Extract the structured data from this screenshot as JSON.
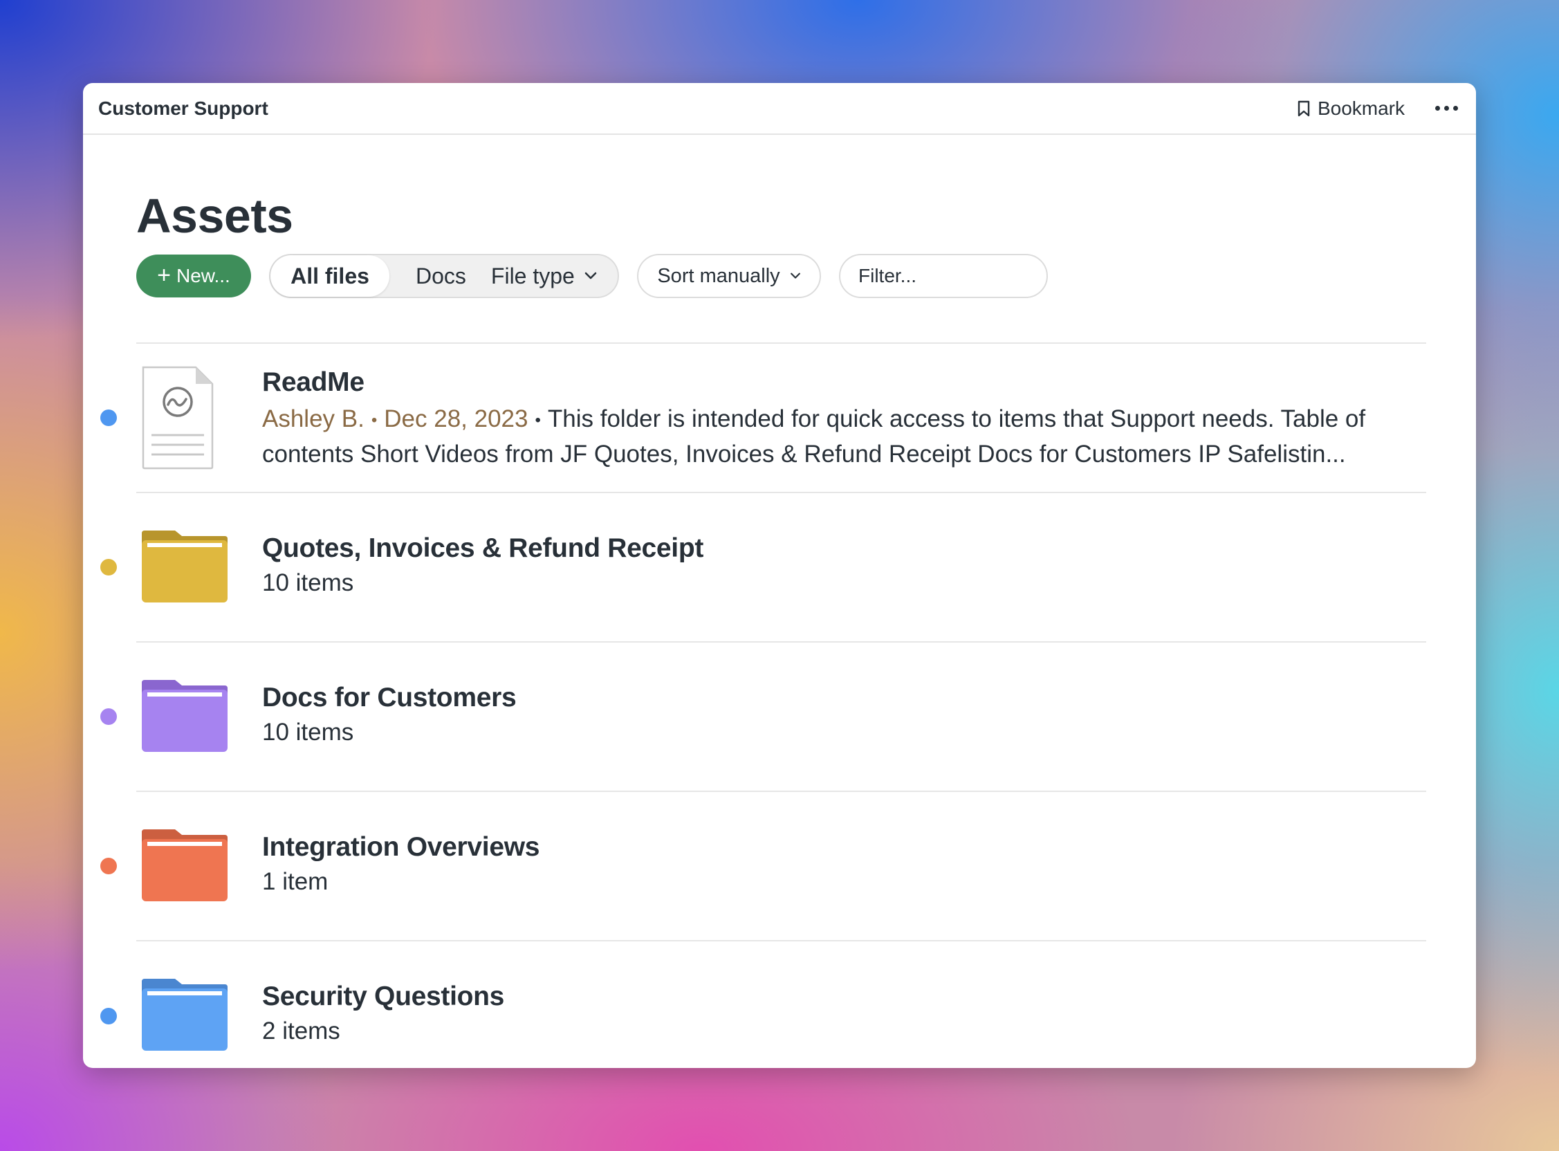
{
  "window": {
    "title": "Customer Support",
    "bookmark_label": "Bookmark"
  },
  "page": {
    "heading": "Assets"
  },
  "toolbar": {
    "new_label": "New...",
    "segments": [
      "All files",
      "Docs",
      "File type"
    ],
    "active_segment": "All files",
    "sort_label": "Sort manually",
    "filter_placeholder": "Filter..."
  },
  "items": [
    {
      "type": "doc",
      "name": "ReadMe",
      "author": "Ashley B.",
      "date": "Dec 28, 2023",
      "excerpt": "This folder is intended for quick access to items that Support needs. Table of contents Short Videos from JF Quotes, Invoices & Refund Receipt Docs for Customers IP Safelistin...",
      "dot_color": "#4f97f0"
    },
    {
      "type": "folder",
      "name": "Quotes, Invoices & Refund Receipt",
      "count": "10 items",
      "color": "#dfb83f",
      "tab_color": "#b8952c",
      "dot_color": "#dfb83f"
    },
    {
      "type": "folder",
      "name": "Docs for Customers",
      "count": "10 items",
      "color": "#a683f0",
      "tab_color": "#8a66cf",
      "dot_color": "#a683f0"
    },
    {
      "type": "folder",
      "name": "Integration Overviews",
      "count": "1 item",
      "color": "#ef7551",
      "tab_color": "#cc5f40",
      "dot_color": "#ef7551"
    },
    {
      "type": "folder",
      "name": "Security Questions",
      "count": "2 items",
      "color": "#5ea3f4",
      "tab_color": "#4a86d0",
      "dot_color": "#4f97f0"
    }
  ],
  "colors": {
    "accent_green": "#3e8e5a",
    "text": "#283038",
    "meta": "#8a6a45"
  }
}
